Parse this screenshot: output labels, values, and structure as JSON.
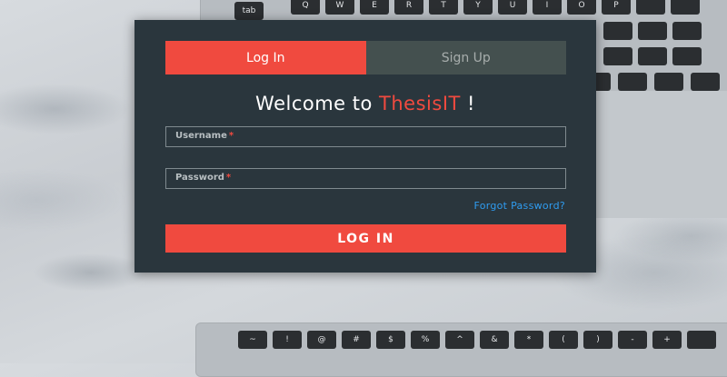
{
  "tabs": {
    "login": "Log In",
    "signup": "Sign Up"
  },
  "heading": {
    "prefix": "Welcome to ",
    "brand": "ThesisIT",
    "suffix": " !"
  },
  "fields": {
    "username": {
      "label": "Username",
      "required": "*"
    },
    "password": {
      "label": "Password",
      "required": "*"
    }
  },
  "forgot_password": "Forgot Password?",
  "login_button": "LOG IN",
  "background_keys": {
    "top": [
      "tab",
      "Q",
      "W",
      "E",
      "R",
      "T",
      "Y",
      "U",
      "I",
      "O",
      "P"
    ],
    "bottom": [
      "~",
      "!",
      "@",
      "#",
      "$",
      "%",
      "^",
      "&",
      "*",
      "(",
      ")",
      "-",
      "+"
    ]
  },
  "colors": {
    "accent": "#f04a3f",
    "panel": "#2a363d",
    "link": "#2f9cf0"
  }
}
